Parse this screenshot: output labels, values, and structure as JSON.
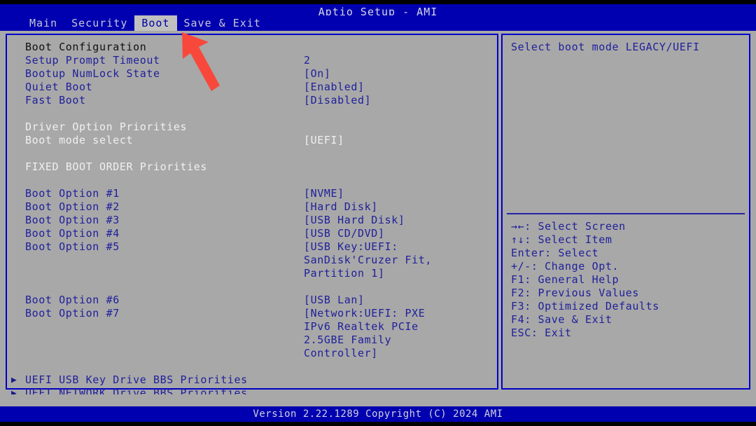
{
  "window": {
    "title": "Aptio Setup - AMI",
    "footer": "Version 2.22.1289 Copyright (C) 2024 AMI"
  },
  "tabs": [
    {
      "label": "Main",
      "active": false
    },
    {
      "label": "Security",
      "active": false
    },
    {
      "label": "Boot",
      "active": true
    },
    {
      "label": "Save & Exit",
      "active": false
    }
  ],
  "main": {
    "section_boot_config": "Boot Configuration",
    "section_driver_priorities": "Driver Option Priorities",
    "section_fixed_boot_order": "FIXED BOOT ORDER Priorities",
    "settings": [
      {
        "label": "Setup Prompt Timeout",
        "value": "2"
      },
      {
        "label": "Bootup NumLock State",
        "value": "[On]"
      },
      {
        "label": "Quiet Boot",
        "value": "[Enabled]"
      },
      {
        "label": "Fast Boot",
        "value": "[Disabled]"
      }
    ],
    "boot_mode": {
      "label": "Boot mode select",
      "value": "[UEFI]"
    },
    "boot_options": [
      {
        "label": "Boot Option #1",
        "value": "[NVME]"
      },
      {
        "label": "Boot Option #2",
        "value": "[Hard Disk]"
      },
      {
        "label": "Boot Option #3",
        "value": "[USB Hard Disk]"
      },
      {
        "label": "Boot Option #4",
        "value": "[USB CD/DVD]"
      },
      {
        "label": "Boot Option #5",
        "value": "[USB Key:UEFI:"
      },
      {
        "label": "",
        "value": "SanDisk'Cruzer Fit,"
      },
      {
        "label": "",
        "value": "Partition 1]"
      },
      {
        "label": "",
        "value": ""
      },
      {
        "label": "Boot Option #6",
        "value": "[USB Lan]"
      },
      {
        "label": "Boot Option #7",
        "value": "[Network:UEFI: PXE"
      },
      {
        "label": "",
        "value": "IPv6 Realtek PCIe"
      },
      {
        "label": "",
        "value": "2.5GBE Family"
      },
      {
        "label": "",
        "value": "Controller]"
      }
    ],
    "submenus": [
      {
        "marker": "▶",
        "label": "UEFI USB Key Drive BBS Priorities"
      },
      {
        "marker": "▶",
        "label": "UEFI NETWORK Drive BBS Priorities"
      }
    ]
  },
  "help": {
    "description": "Select boot mode LEGACY/UEFI",
    "keys": [
      "→←: Select Screen",
      "↑↓: Select Item",
      "Enter: Select",
      "+/-: Change Opt.",
      "F1: General Help",
      "F2: Previous Values",
      "F3: Optimized Defaults",
      "F4: Save & Exit",
      "ESC: Exit"
    ]
  },
  "annotation": {
    "arrow_color": "#f8483c",
    "arrow_name": "red-pointer-arrow"
  },
  "colors": {
    "bios_blue": "#0000b0",
    "panel_gray": "#a8a8a8",
    "text_blue": "#20209c",
    "text_white": "#f0f0f0",
    "border_blue": "#0000c8"
  }
}
